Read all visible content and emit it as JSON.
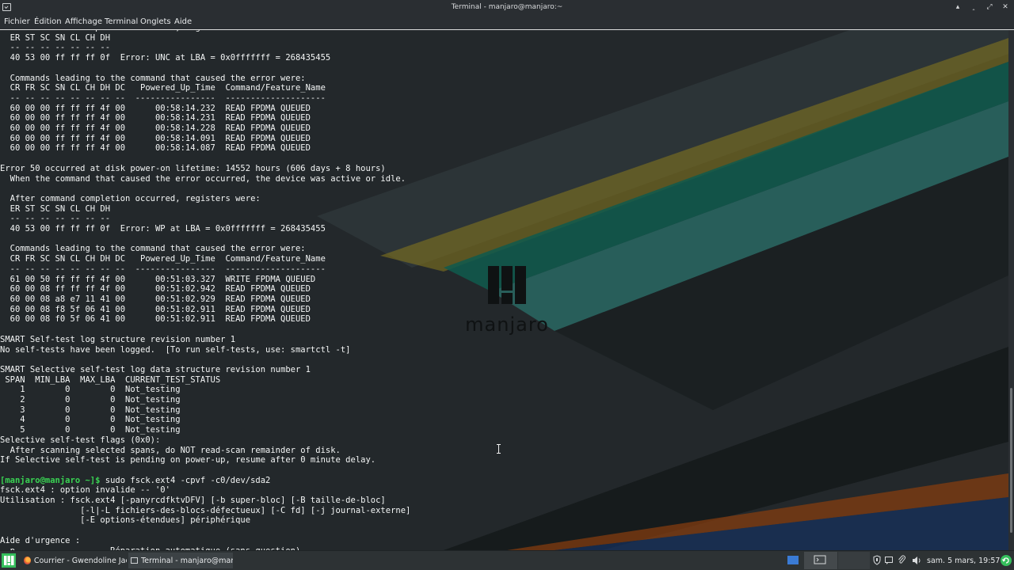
{
  "window": {
    "title": "Terminal - manjaro@manjaro:~",
    "buttons": [
      "▴",
      "‸",
      "⤢",
      "✕"
    ]
  },
  "menubar": {
    "items": [
      "Fichier",
      "Édition",
      "Affichage",
      "Terminal",
      "Onglets",
      "Aide"
    ]
  },
  "terminal": {
    "lines": [
      "  After command completion occurred, registers were:",
      "  ER ST SC SN CL CH DH",
      "  -- -- -- -- -- -- --",
      "  40 53 00 ff ff ff 0f  Error: UNC at LBA = 0x0fffffff = 268435455",
      "",
      "  Commands leading to the command that caused the error were:",
      "  CR FR SC SN CL CH DH DC   Powered_Up_Time  Command/Feature_Name",
      "  -- -- -- -- -- -- -- --  ----------------  --------------------",
      "  60 00 00 ff ff ff 4f 00      00:58:14.232  READ FPDMA QUEUED",
      "  60 00 00 ff ff ff 4f 00      00:58:14.231  READ FPDMA QUEUED",
      "  60 00 00 ff ff ff 4f 00      00:58:14.228  READ FPDMA QUEUED",
      "  60 00 00 ff ff ff 4f 00      00:58:14.091  READ FPDMA QUEUED",
      "  60 00 00 ff ff ff 4f 00      00:58:14.087  READ FPDMA QUEUED",
      "",
      "Error 50 occurred at disk power-on lifetime: 14552 hours (606 days + 8 hours)",
      "  When the command that caused the error occurred, the device was active or idle.",
      "",
      "  After command completion occurred, registers were:",
      "  ER ST SC SN CL CH DH",
      "  -- -- -- -- -- -- --",
      "  40 53 00 ff ff ff 0f  Error: WP at LBA = 0x0fffffff = 268435455",
      "",
      "  Commands leading to the command that caused the error were:",
      "  CR FR SC SN CL CH DH DC   Powered_Up_Time  Command/Feature_Name",
      "  -- -- -- -- -- -- -- --  ----------------  --------------------",
      "  61 00 50 ff ff ff 4f 00      00:51:03.327  WRITE FPDMA QUEUED",
      "  60 00 08 ff ff ff 4f 00      00:51:02.942  READ FPDMA QUEUED",
      "  60 00 08 a8 e7 11 41 00      00:51:02.929  READ FPDMA QUEUED",
      "  60 00 08 f8 5f 06 41 00      00:51:02.911  READ FPDMA QUEUED",
      "  60 00 08 f0 5f 06 41 00      00:51:02.911  READ FPDMA QUEUED",
      "",
      "SMART Self-test log structure revision number 1",
      "No self-tests have been logged.  [To run self-tests, use: smartctl -t]",
      "",
      "SMART Selective self-test log data structure revision number 1",
      " SPAN  MIN_LBA  MAX_LBA  CURRENT_TEST_STATUS",
      "    1        0        0  Not_testing",
      "    2        0        0  Not_testing",
      "    3        0        0  Not_testing",
      "    4        0        0  Not_testing",
      "    5        0        0  Not_testing",
      "Selective self-test flags (0x0):",
      "  After scanning selected spans, do NOT read-scan remainder of disk.",
      "If Selective self-test is pending on power-up, resume after 0 minute delay.",
      ""
    ],
    "prompt": "[manjaro@manjaro ~]$",
    "command": " sudo fsck.ext4 -cpvf -c0/dev/sda2",
    "output_lines": [
      "fsck.ext4 : option invalide -- '0'",
      "Utilisation : fsck.ext4 [-panyrcdfktvDFV] [-b super-bloc] [-B taille-de-bloc]",
      "                [-l|-L fichiers-des-blocs-défectueux] [-C fd] [-j journal-externe]",
      "                [-E options-étendues] périphérique",
      "",
      "Aide d'urgence :",
      " -p                   Réparation automatique (sans question)"
    ]
  },
  "wallpaper": {
    "logo_text": "manjaro"
  },
  "taskbar": {
    "tasks": [
      {
        "label": "Courrier - Gwendoline Jaci...",
        "icon": "firefox-icon"
      },
      {
        "label": "Terminal - manjaro@manj...",
        "icon": "terminal-icon",
        "active": true
      }
    ],
    "clock": "sam. 5 mars, 19:57",
    "tray_icons": [
      "shield-icon",
      "chat-icon",
      "paperclip-icon",
      "volume-icon",
      "update-icon"
    ]
  }
}
